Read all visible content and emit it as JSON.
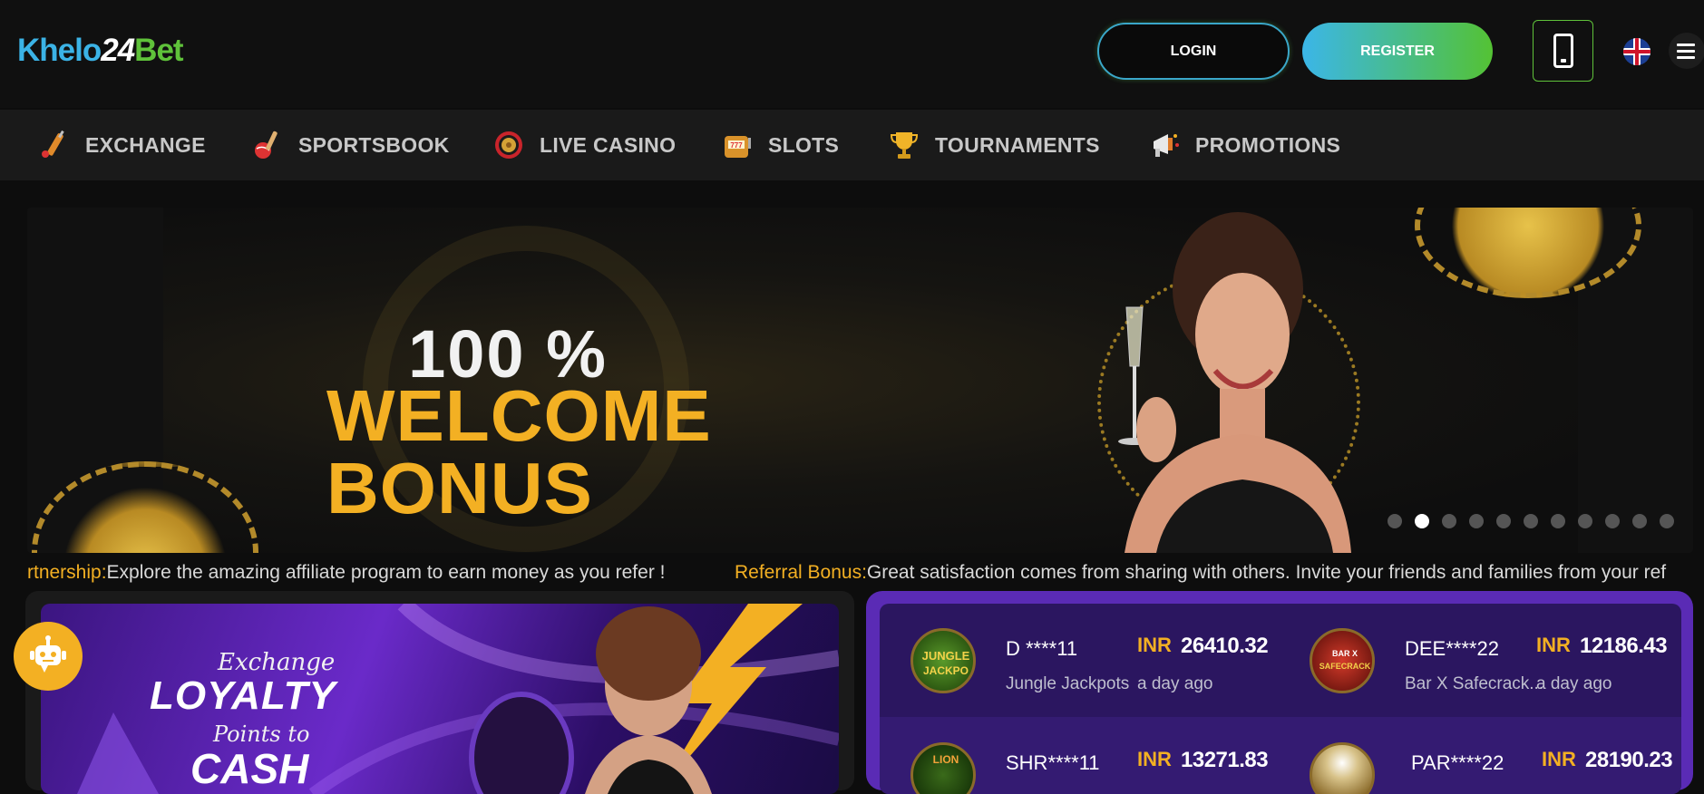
{
  "header": {
    "logo": {
      "part1": "Khelo",
      "part2": "24",
      "part3": "Bet"
    },
    "login_label": "LOGIN",
    "register_label": "REGISTER"
  },
  "nav": {
    "items": [
      {
        "label": "EXCHANGE",
        "icon": "cricket-bat-icon"
      },
      {
        "label": "SPORTSBOOK",
        "icon": "sports-ball-icon"
      },
      {
        "label": "LIVE CASINO",
        "icon": "roulette-icon"
      },
      {
        "label": "SLOTS",
        "icon": "slot-machine-icon"
      },
      {
        "label": "TOURNAMENTS",
        "icon": "trophy-icon"
      },
      {
        "label": "PROMOTIONS",
        "icon": "megaphone-icon"
      }
    ]
  },
  "hero": {
    "percent": "100 %",
    "title": "WELCOME BONUS",
    "slide_count": 11,
    "active_slide": 2
  },
  "ticker": [
    {
      "label": "rtnership:",
      "text": "Explore the amazing affiliate program to earn money as you refer !"
    },
    {
      "label": "Referral Bonus:",
      "text": "Great satisfaction comes from sharing with others. Invite your friends and families from your ref"
    }
  ],
  "promo": {
    "line1": "Exchange",
    "line2": "LOYALTY",
    "line3": "Points to",
    "line4": "CASH"
  },
  "winners": [
    {
      "user": "D ****11",
      "game": "Jungle Jackpots",
      "currency": "INR",
      "amount": "26410.32",
      "time": "a day ago"
    },
    {
      "user": "DEE****22",
      "game": "Bar X Safecrack...",
      "currency": "INR",
      "amount": "12186.43",
      "time": "a day ago"
    },
    {
      "user": "SHR****11",
      "game": "",
      "currency": "INR",
      "amount": "13271.83",
      "time": ""
    },
    {
      "user": "PAR****22",
      "game": "",
      "currency": "INR",
      "amount": "28190.23",
      "time": ""
    }
  ],
  "colors": {
    "accent_gold": "#f3b023",
    "brand_blue": "#3bb6e8",
    "brand_green": "#54c234",
    "purple": "#5a2bb5"
  }
}
